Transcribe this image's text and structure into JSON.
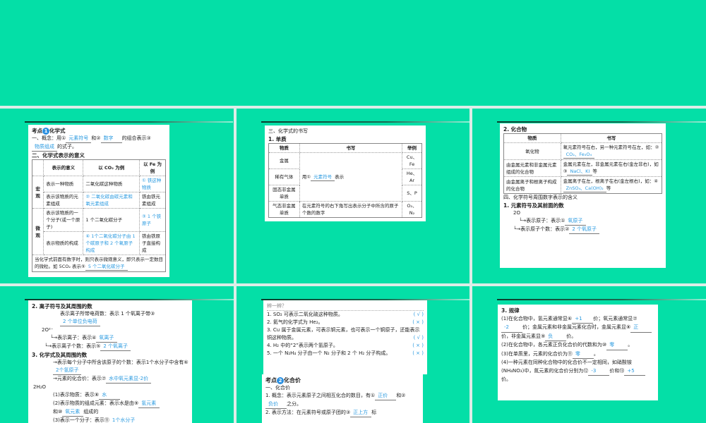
{
  "colors": {
    "background": "#04DFA7",
    "answer": "#2a9ae0"
  },
  "s1": {
    "title_pre": "考点",
    "title_num": "1",
    "title": "化学式",
    "l1a": "一、概念：用①",
    "a1": "元素符号",
    "l1b": "和②",
    "a2": "数字",
    "l1c": "的组合表示③",
    "a3": "物质组成",
    "l1d": "的式子。",
    "h2": "二、化学式表示的意义",
    "headers": [
      "表示的意义",
      "以 CO₂ 为例",
      "以 Fe 为例"
    ],
    "macro": "宏观",
    "micro": "微观",
    "rows": [
      [
        "表示一种物质",
        "二氧化碳这种物质",
        "① 铁这种物质"
      ],
      [
        "表示该物质的元素组成",
        "② 二氧化碳由碳元素和氧元素组成",
        "铁由铁元素组成"
      ],
      [
        "表示该物质的一个分子(或一个原子)",
        "1 个二氧化碳分子",
        "③ 1 个铁原子"
      ],
      [
        "表示物质的构成",
        "④ 1个二氧化碳分子由 1 个碳原子和 2 个氧原子构成",
        "铁由铁原子直接构成"
      ]
    ],
    "note": "当化学式前面有数字时，则只表示微观意义，即只表示一定数目的微粒。如 5CO₂ 表示⑤",
    "note_a": "5 个二氧化碳分子"
  },
  "s2": {
    "h1": "三、化学式的书写",
    "h2": "1. 单质",
    "headers": [
      "物质",
      "书写",
      "举例"
    ],
    "r": [
      [
        "金属",
        "Cu、Fe"
      ],
      [
        "稀有气体",
        "He、Ar"
      ],
      [
        "固态非金属单质",
        "S、P"
      ],
      [
        "气态非金属单质",
        "O₂、N₂"
      ]
    ],
    "w1a": "用①",
    "w1ans": "元素符号",
    "w1b": "表示",
    "w2": "在元素符号的右下角写出表示分子中所含的原子个数的数字"
  },
  "s3": {
    "h": "2. 化合物",
    "headers": [
      "物质",
      "书写"
    ],
    "rows": [
      [
        "氧化物",
        "氧元素符号在右，另一种元素符号在左，如：②",
        "CO₂、Fe₃O₄",
        ""
      ],
      [
        "由金属元素和非金属元素组成的化合物",
        "金属元素在左，非金属元素在右(金左非右)，如③",
        "NaCl、KI",
        "等"
      ],
      [
        "由金属离子和根离子构成的化合物",
        "金属离子在左，根离子在右(金左根右)，如：④",
        "ZnSO₄、Ca(OH)₂",
        "等"
      ]
    ],
    "h4": "四、化学符号周围数字表示的含义",
    "h5": "1. 元素符号及其前面的数",
    "formula": "2O",
    "b1": "表示原子：表示①",
    "b1a": "氧原子",
    "b2": "表示原子个数：表示②",
    "b2a": "2 个氧原子"
  },
  "s4": {
    "h": "2. 离子符号及其周围的数",
    "formula": "2O²⁻",
    "l1": "表示离子所带电荷数：表示 1 个氧离子带③",
    "l1a": "2 个单位负电荷",
    "l2": "表示离子：表示④",
    "l2a": "氧离子",
    "l3": "表示离子个数：表示⑤",
    "l3a": "2 个氧离子",
    "h3": "3. 化学式及其周围的数",
    "formula2": "2H₂O",
    "m1": "表示每个分子中所含该原子的个数：表示1个水分子中含有⑥",
    "m1a": "2个氢原子",
    "m2": "元素的化合价：表示⑦",
    "m2a": "水中氧元素显-2价",
    "m3": "(1)表示物质：表示⑧",
    "m3a": "水",
    "m4": "(2)表示物质的组成元素：表示水是由⑨",
    "m4a": "氢元素",
    "m5": "和⑩",
    "m5a": "氧元素",
    "m5b": "组成的",
    "m6": "(3)表示一个分子：表示⑪",
    "m6a": "1个水分子"
  },
  "s5": {
    "title": "辨一辨？",
    "items": [
      [
        "1. SO₂ 可表示二氧化硫这种物质。",
        "( √ )"
      ],
      [
        "2. 氦气的化学式为 He₂。",
        "( × )"
      ],
      [
        "3. Cu 属于金属元素，可表示铜元素，也可表示一个铜原子，还能表示铜这种物质。",
        "( √ )"
      ],
      [
        "4. H₂ 中的“2”表示两个氢原子。",
        "( × )"
      ],
      [
        "5. 一个 N₂H₄ 分子由一个 N₂ 分子和 2 个 H₂ 分子构成。",
        "( × )"
      ]
    ],
    "t_pre": "考点",
    "t_num": "2",
    "t": "化合价",
    "h1": "一、化合价",
    "c1": "1. 概念：表示元素原子之间相互化合的数目，有①",
    "c1a": "正价",
    "c1b": "和②",
    "c1c": "负价",
    "c1d": "之分。",
    "c2": "2. 表示方法：在元素符号或原子团的③",
    "c2a": "正上方",
    "c2b": "标"
  },
  "s6": {
    "h": "3. 规律",
    "p1": "(1)在化合物中，氢元素通常显⑥",
    "p1a": "+1",
    "p1b": "价；氧元素通常显⑦",
    "p1c": "-2",
    "p1d": "价；金属元素和非金属元素化合时，金属元素显⑧",
    "p1e": "正",
    "p1f": "价，非金属元素显⑨",
    "p1g": "负",
    "p1h": "价。",
    "p2": "(2)在化合物中，各元素正负化合价的代数和为⑩",
    "p2a": "零",
    "p2b": "。",
    "p3": "(3)在单质里，元素的化合价为⑪",
    "p3a": "零",
    "p3b": "。",
    "p4": "(4)一种元素在同种化合物中的化合价不一定相同，如硝酸铵(NH₄NO₃)中，氮元素的化合价分别为⑫",
    "p4a": "-3",
    "p4b": "价和⑬",
    "p4c": "+5",
    "p4d": "价。"
  }
}
